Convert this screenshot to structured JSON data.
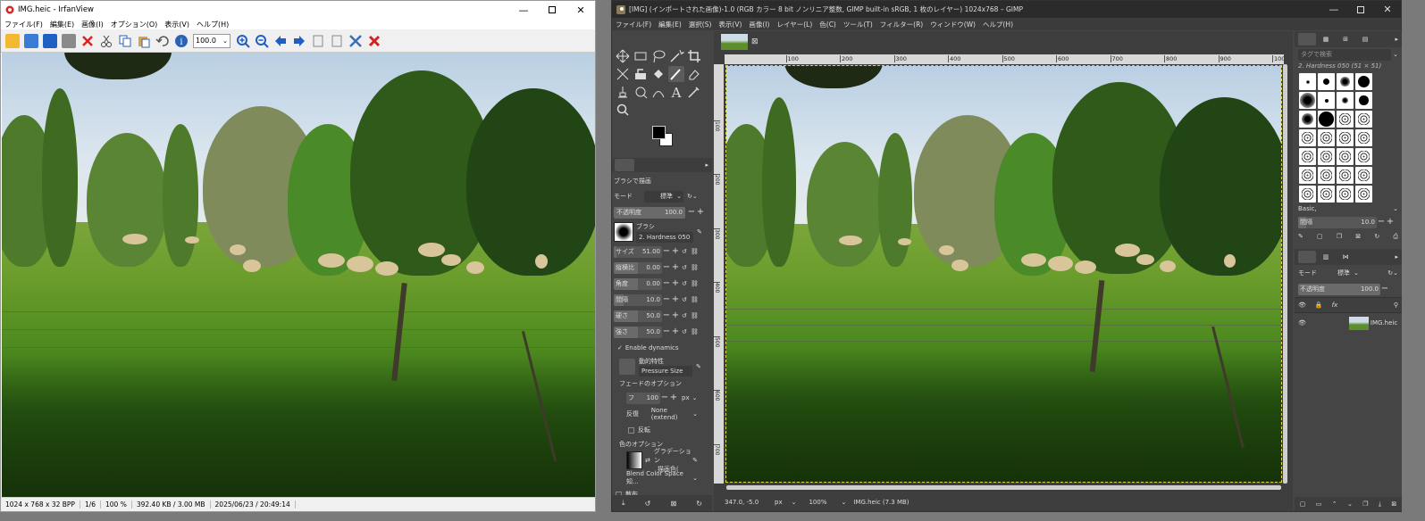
{
  "irfanview": {
    "title": "IMG.heic - IrfanView",
    "menu": [
      "ファイル(F)",
      "編集(E)",
      "画像(I)",
      "オプション(O)",
      "表示(V)",
      "ヘルプ(H)"
    ],
    "zoom_value": "100.0",
    "status": [
      "1024 x 768 x 32 BPP",
      "1/6",
      "100 %",
      "392.40 KB / 3.00 MB",
      "2025/06/23 / 20:49:14"
    ]
  },
  "gimp": {
    "title": "[IMG] (インポートされた画像)-1.0 (RGB カラー 8 bit ノンリニア整数, GIMP built-in sRGB, 1 枚のレイヤー) 1024x768 – GIMP",
    "menu": [
      "ファイル(F)",
      "編集(E)",
      "選択(S)",
      "表示(V)",
      "画像(I)",
      "レイヤー(L)",
      "色(C)",
      "ツール(T)",
      "フィルター(R)",
      "ウィンドウ(W)",
      "ヘルプ(H)"
    ],
    "ruler_ticks": [
      "100",
      "200",
      "300",
      "400",
      "500",
      "600",
      "700",
      "800",
      "900",
      "1000"
    ],
    "vruler_ticks": [
      "100",
      "200",
      "300",
      "400",
      "500",
      "600",
      "700"
    ],
    "tool_options": {
      "header": "ブラシで描画",
      "mode_label": "モード",
      "mode_value": "標準",
      "opacity_label": "不透明度",
      "opacity_value": "100.0",
      "opacity_fraction": 1.0,
      "brush_label": "ブラシ",
      "brush_name": "2. Hardness 050",
      "sliders": [
        {
          "label": "サイズ",
          "value": "51.00",
          "fraction": 0.05
        },
        {
          "label": "縦横比",
          "value": "0.00",
          "fraction": 0.5
        },
        {
          "label": "角度",
          "value": "0.00",
          "fraction": 0.5
        },
        {
          "label": "間隔",
          "value": "10.0",
          "fraction": 0.2
        },
        {
          "label": "硬さ",
          "value": "50.0",
          "fraction": 0.5
        },
        {
          "label": "強さ",
          "value": "50.0",
          "fraction": 0.5
        }
      ],
      "enable_dynamics": "Enable dynamics",
      "dynamics_label": "動的特性",
      "dynamics_value": "Pressure Size",
      "fade_header": "フェードのオプション",
      "fade_length_label": "フ",
      "fade_length": "100",
      "fade_unit": "px",
      "repeat_label": "反復",
      "repeat_value": "None (extend)",
      "reverse_label": "反転",
      "color_options_header": "色のオプション",
      "gradient_label": "グラデーション",
      "gradient_sub": "描画色(",
      "blend_space": "Blend Color Space 知...",
      "scatter_label": "散布"
    },
    "status": {
      "coords": "347.0, -5.0",
      "unit": "px",
      "zoom": "100%",
      "file": "IMG.heic (7.3 MB)"
    },
    "brushes_panel": {
      "filter_placeholder": "タグで検索",
      "selected_brush": "2. Hardness 050 (51 × 51)",
      "preset": "Basic,",
      "spacing_label": "間隔",
      "spacing_value": "10.0"
    },
    "layers_panel": {
      "mode_label": "モード",
      "mode_value": "標準",
      "opacity_label": "不透明度",
      "opacity_value": "100.0",
      "layer_name": "IMG.heic"
    }
  }
}
